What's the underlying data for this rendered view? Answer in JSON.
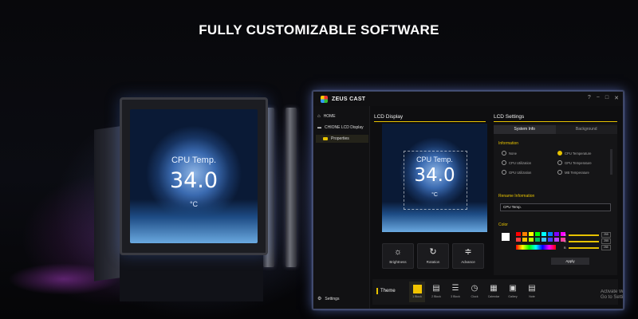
{
  "headline": "FULLY CUSTOMIZABLE SOFTWARE",
  "hardware": {
    "lcd": {
      "label": "CPU Temp.",
      "value": "34.0",
      "unit": "°C"
    }
  },
  "app": {
    "title": "ZEUS CAST",
    "window_controls": [
      "?",
      "−",
      "□",
      "✕"
    ],
    "sidebar": {
      "home": "HOME",
      "device": "CHIONE LCD Display",
      "properties": "Properties",
      "settings": "Settings"
    },
    "lcd_display": {
      "heading": "LCD Display",
      "label": "CPU Temp.",
      "value": "34.0",
      "unit": "°C",
      "tools": [
        {
          "label": "Brightness",
          "icon": "sun-icon"
        },
        {
          "label": "Rotation",
          "icon": "rotate-icon"
        },
        {
          "label": "Advance",
          "icon": "sliders-icon"
        }
      ]
    },
    "lcd_settings": {
      "heading": "LCD Settings",
      "tabs": [
        "System Info",
        "Background"
      ],
      "information_heading": "Information",
      "options": [
        "None",
        "CPU Temperature",
        "CPU Utilization",
        "GPU Temperature",
        "GPU Utilization",
        "MB Temperature"
      ],
      "selected_option": "CPU Temperature",
      "rename_heading": "Rename Information",
      "rename_value": "CPU Temp.",
      "color_heading": "Color",
      "rgb": [
        {
          "channel": "R",
          "value": "255",
          "level": 1.0
        },
        {
          "channel": "G",
          "value": "255",
          "level": 1.0
        },
        {
          "channel": "B",
          "value": "255",
          "level": 1.0
        }
      ],
      "palette": [
        "#ff0000",
        "#ff8000",
        "#ffff00",
        "#00ff00",
        "#00ffff",
        "#0080ff",
        "#8000ff",
        "#ff00ff",
        "#ff4040",
        "#ffc000",
        "#c0ff00",
        "#00c060",
        "#40c0ff",
        "#4040ff",
        "#c040ff",
        "#ff40a0"
      ],
      "apply": "Apply"
    },
    "theme": {
      "label": "Theme",
      "items": [
        {
          "label": "1 Block",
          "icon": "single-block-icon",
          "selected": true
        },
        {
          "label": "2 Block",
          "icon": "two-block-icon",
          "selected": false
        },
        {
          "label": "3 Block",
          "icon": "three-block-icon",
          "selected": false
        },
        {
          "label": "Clock",
          "icon": "clock-icon",
          "selected": false
        },
        {
          "label": "Calendar",
          "icon": "calendar-icon",
          "selected": false
        },
        {
          "label": "Gallery",
          "icon": "gallery-icon",
          "selected": false
        },
        {
          "label": "Note",
          "icon": "note-icon",
          "selected": false
        }
      ]
    },
    "watermark": "Activate W…\nGo to Setting…"
  }
}
